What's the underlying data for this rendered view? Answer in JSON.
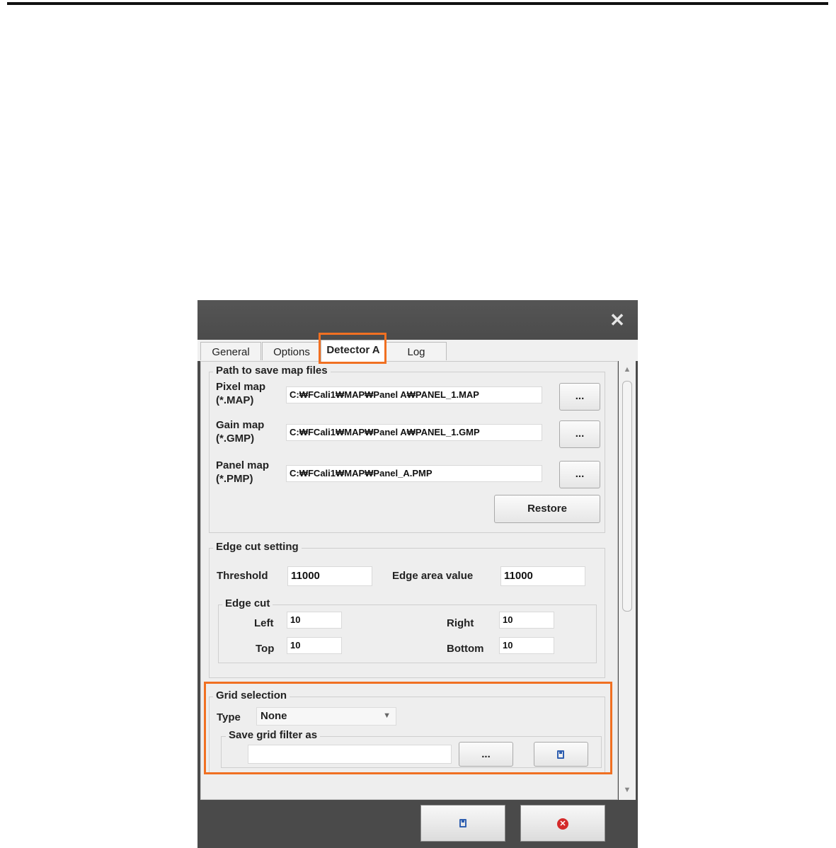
{
  "window": {
    "close_icon": "close-icon"
  },
  "tabs": [
    {
      "label": "General"
    },
    {
      "label": "Options"
    },
    {
      "label": "Detector A"
    },
    {
      "label": "Log"
    }
  ],
  "map_files": {
    "title": "Path to save map files",
    "pixel": {
      "label1": "Pixel map",
      "label2": "(*.MAP)",
      "value": "C:₩FCali1₩MAP₩Panel A₩PANEL_1.MAP",
      "browse": "..."
    },
    "gain": {
      "label1": "Gain map",
      "label2": "(*.GMP)",
      "value": "C:₩FCali1₩MAP₩Panel A₩PANEL_1.GMP",
      "browse": "..."
    },
    "panel": {
      "label1": "Panel map",
      "label2": "(*.PMP)",
      "value": "C:₩FCali1₩MAP₩Panel_A.PMP",
      "browse": "..."
    },
    "restore": "Restore"
  },
  "edge": {
    "title": "Edge cut setting",
    "threshold_label": "Threshold",
    "threshold_value": "11000",
    "area_label": "Edge area value",
    "area_value": "11000",
    "cut": {
      "title": "Edge cut",
      "left_label": "Left",
      "left_value": "10",
      "right_label": "Right",
      "right_value": "10",
      "top_label": "Top",
      "top_value": "10",
      "bottom_label": "Bottom",
      "bottom_value": "10"
    }
  },
  "grid": {
    "title": "Grid selection",
    "type_label": "Type",
    "type_value": "None",
    "save_title": "Save grid filter as",
    "save_value": "",
    "browse": "..."
  },
  "colors": {
    "highlight": "#f07022",
    "titlebar": "#4a4a4a"
  }
}
